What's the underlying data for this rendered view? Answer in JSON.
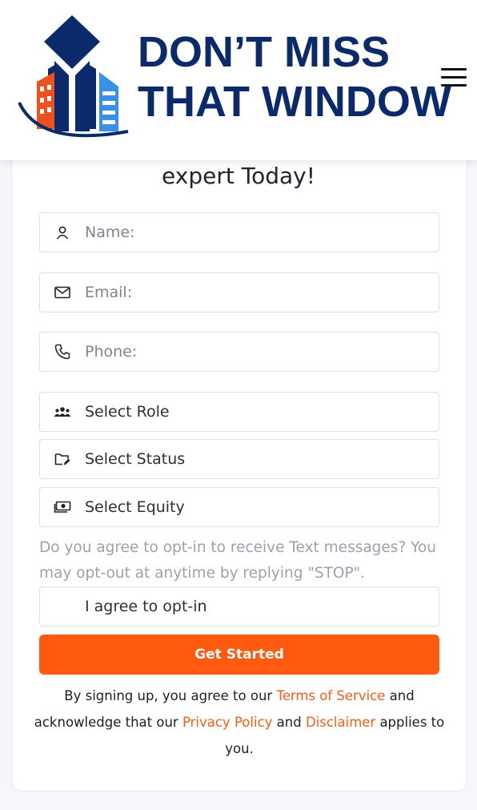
{
  "header": {
    "logo_line1": "DON’T MISS",
    "logo_line2": "THAT WINDOW",
    "brand_navy": "#0b2a6b",
    "brand_blue": "#3a8fe6",
    "brand_orange": "#f0501e",
    "menu_icon": "hamburger-icon"
  },
  "form": {
    "title": "expert Today!",
    "name_placeholder": "Name:",
    "email_placeholder": "Email:",
    "phone_placeholder": "Phone:",
    "role_select": "Select Role",
    "status_select": "Select Status",
    "equity_select": "Select Equity",
    "optin_question": "Do you agree to opt-in to receive Text messages? You may opt-out at anytime by replying \"STOP\".",
    "optin_select": "I agree to opt-in",
    "submit_label": "Get Started",
    "accent_color": "#ff5a10"
  },
  "legal": {
    "prefix": "By signing up, you agree to our ",
    "terms_link": "Terms of Service",
    "middle": " and acknowledge that our ",
    "privacy_link": "Privacy Policy",
    "and": " and ",
    "disclaimer_link": "Disclaimer",
    "suffix": " applies to you."
  }
}
